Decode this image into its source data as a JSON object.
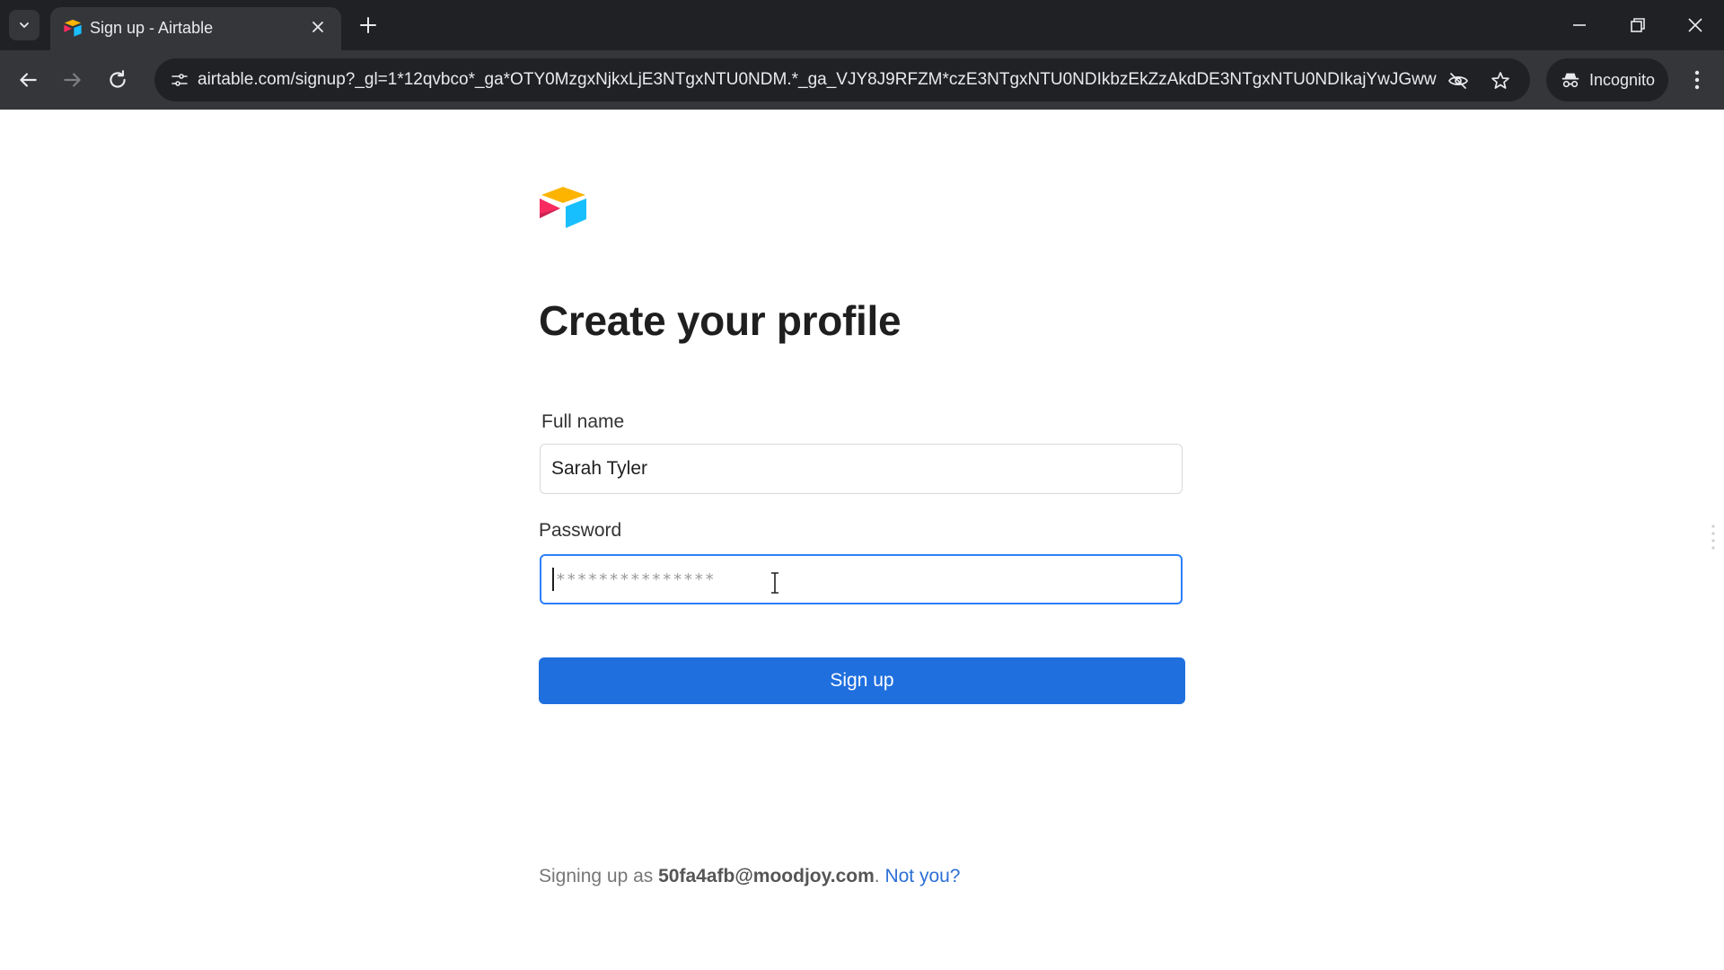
{
  "browser": {
    "tab": {
      "title": "Sign up - Airtable"
    },
    "address_bar": {
      "url": "airtable.com/signup?_gl=1*12qvbco*_ga*OTY0MzgxNjkxLjE3NTgxNTU0NDM.*_ga_VJY8J9RFZM*czE3NTgxNTU0NDIkbzEkZzAkdDE3NTgxNTU0NDIkajYwJGww..."
    },
    "profile": {
      "label": "Incognito"
    }
  },
  "page": {
    "heading": "Create your profile",
    "full_name": {
      "label": "Full name",
      "value": "Sarah Tyler"
    },
    "password": {
      "label": "Password",
      "masked_value": "***************"
    },
    "signup_button": "Sign up",
    "footer": {
      "prefix": "Signing up as",
      "email": "50fa4afb@moodjoy.com",
      "separator": ".",
      "not_you": "Not you?"
    }
  },
  "colors": {
    "primary_button": "#1f6fde",
    "focus_border": "#2d7ff9",
    "link": "#2d6fd6",
    "chrome_dark": "#202124",
    "chrome_toolbar": "#35363a"
  },
  "icons": {
    "tab_search": "chevron-down-icon",
    "favicon": "airtable-logo-icon",
    "tab_close": "close-icon",
    "new_tab": "plus-icon",
    "minimize": "minimize-icon",
    "restore": "restore-icon",
    "window_close": "close-icon",
    "back": "arrow-left-icon",
    "forward": "arrow-right-icon",
    "reload": "reload-icon",
    "site_info": "tune-icon",
    "eye_off": "eye-off-icon",
    "bookmark": "star-icon",
    "incognito": "incognito-icon",
    "menu": "kebab-menu-icon",
    "text_cursor": "text-cursor-icon"
  }
}
